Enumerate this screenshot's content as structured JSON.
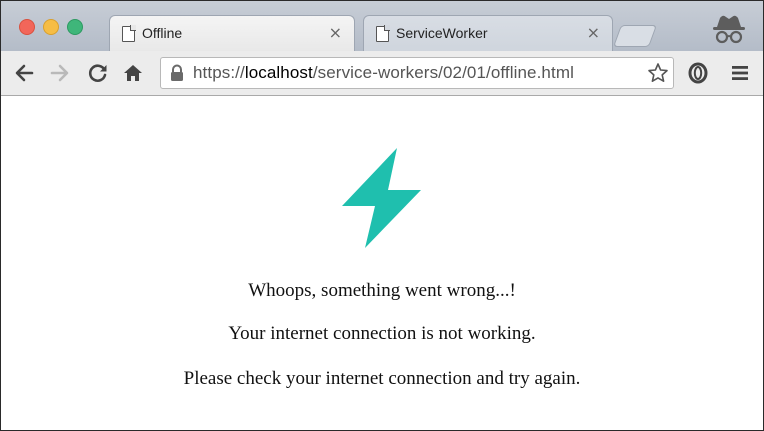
{
  "window": {
    "tabs": [
      {
        "title": "Offline",
        "active": true
      },
      {
        "title": "ServiceWorker",
        "active": false
      }
    ],
    "tab_close_glyph": "×"
  },
  "toolbar": {
    "url_scheme": "https://",
    "url_host": "localhost",
    "url_path": "/service-workers/02/01/offline.html"
  },
  "page": {
    "logo_color": "#1fbfae",
    "heading": "Whoops, something went wrong...!",
    "message": "Your internet connection is not working.",
    "instruction": "Please check your internet connection and try again."
  }
}
